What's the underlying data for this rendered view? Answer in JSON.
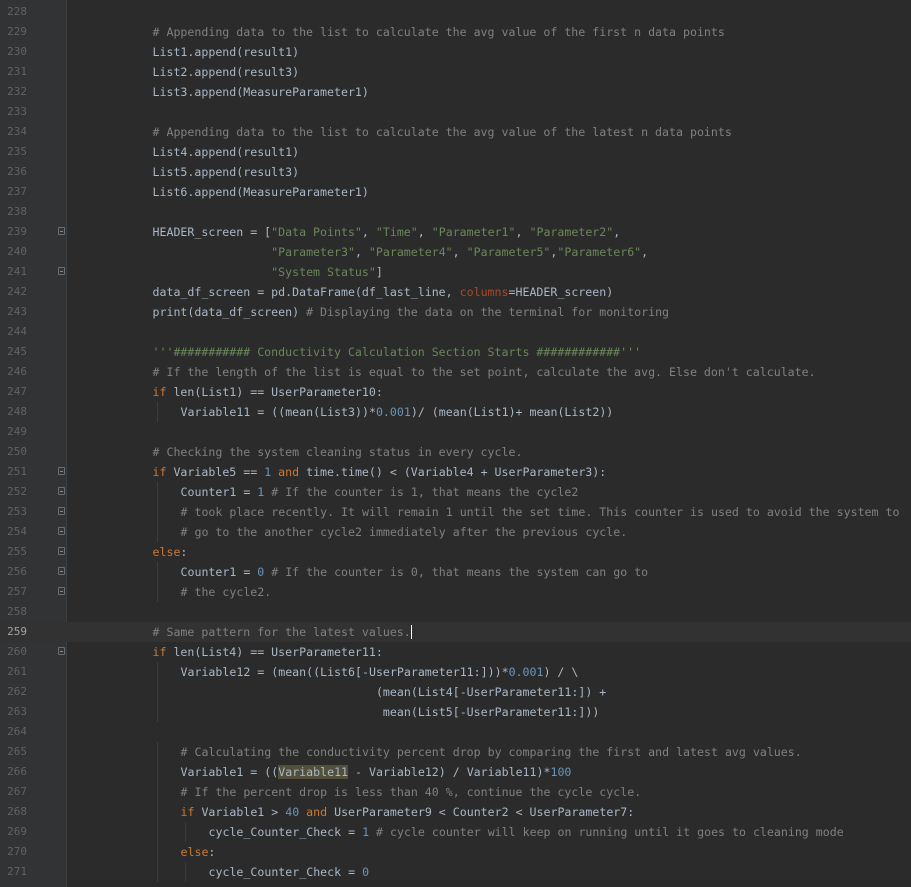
{
  "editor": {
    "colors": {
      "background": "#2b2b2b",
      "gutter": "#313335",
      "keyword": "#cc7832",
      "string": "#6a8759",
      "comment": "#808080",
      "number": "#6897bb",
      "text": "#a9b7c6",
      "kwarg": "#aa4926"
    },
    "current_line": 259,
    "lines": [
      {
        "n": "228",
        "i": 0,
        "s": []
      },
      {
        "n": "229",
        "i": 1,
        "s": [
          [
            "cm",
            "# Appending data to the list to calculate the avg value of the first n data points"
          ]
        ]
      },
      {
        "n": "230",
        "i": 1,
        "s": [
          [
            "t",
            "List1.append(result1)"
          ]
        ]
      },
      {
        "n": "231",
        "i": 1,
        "s": [
          [
            "t",
            "List2.append(result3)"
          ]
        ]
      },
      {
        "n": "232",
        "i": 1,
        "s": [
          [
            "t",
            "List3.append(MeasureParameter1)"
          ]
        ]
      },
      {
        "n": "233",
        "i": 0,
        "s": []
      },
      {
        "n": "234",
        "i": 1,
        "s": [
          [
            "cm",
            "# Appending data to the list to calculate the avg value of the latest n data points"
          ]
        ]
      },
      {
        "n": "235",
        "i": 1,
        "s": [
          [
            "t",
            "List4.append(result1)"
          ]
        ]
      },
      {
        "n": "236",
        "i": 1,
        "s": [
          [
            "t",
            "List5.append(result3)"
          ]
        ]
      },
      {
        "n": "237",
        "i": 1,
        "s": [
          [
            "t",
            "List6.append(MeasureParameter1)"
          ]
        ]
      },
      {
        "n": "238",
        "i": 0,
        "s": []
      },
      {
        "n": "239",
        "i": 1,
        "f": true,
        "s": [
          [
            "t",
            "HEADER_screen = ["
          ],
          [
            "st",
            "\"Data Points\""
          ],
          [
            "t",
            ", "
          ],
          [
            "st",
            "\"Time\""
          ],
          [
            "t",
            ", "
          ],
          [
            "st",
            "\"Parameter1\""
          ],
          [
            "t",
            ", "
          ],
          [
            "st",
            "\"Parameter2\""
          ],
          [
            "t",
            ","
          ]
        ]
      },
      {
        "n": "240",
        "i": 1,
        "s": [
          [
            "t",
            "                 "
          ],
          [
            "st",
            "\"Parameter3\""
          ],
          [
            "t",
            ", "
          ],
          [
            "st",
            "\"Parameter4\""
          ],
          [
            "t",
            ", "
          ],
          [
            "st",
            "\"Parameter5\""
          ],
          [
            "t",
            ","
          ],
          [
            "st",
            "\"Parameter6\""
          ],
          [
            "t",
            ","
          ]
        ]
      },
      {
        "n": "241",
        "i": 1,
        "f": true,
        "s": [
          [
            "t",
            "                 "
          ],
          [
            "st",
            "\"System Status\""
          ],
          [
            "t",
            "]"
          ]
        ]
      },
      {
        "n": "242",
        "i": 1,
        "s": [
          [
            "t",
            "data_df_screen = pd.DataFrame(df_last_line, "
          ],
          [
            "kp",
            "columns"
          ],
          [
            "t",
            "=HEADER_screen)"
          ]
        ]
      },
      {
        "n": "243",
        "i": 1,
        "s": [
          [
            "t",
            "print(data_df_screen) "
          ],
          [
            "cm",
            "# Displaying the data on the terminal for monitoring"
          ]
        ]
      },
      {
        "n": "244",
        "i": 0,
        "s": []
      },
      {
        "n": "245",
        "i": 1,
        "s": [
          [
            "st",
            "'''########### Conductivity Calculation Section Starts ############'''"
          ]
        ]
      },
      {
        "n": "246",
        "i": 1,
        "s": [
          [
            "cm",
            "# If the length of the list is equal to the set point, calculate the avg. Else don't calculate."
          ]
        ]
      },
      {
        "n": "247",
        "i": 1,
        "s": [
          [
            "kw",
            "if "
          ],
          [
            "t",
            "len(List1) == UserParameter10:"
          ]
        ]
      },
      {
        "n": "248",
        "i": 2,
        "s": [
          [
            "t",
            "Variable11 = ((mean(List3))*"
          ],
          [
            "nm",
            "0.001"
          ],
          [
            "t",
            ")/ (mean(List1)+ mean(List2))"
          ]
        ]
      },
      {
        "n": "249",
        "i": 0,
        "s": []
      },
      {
        "n": "250",
        "i": 1,
        "s": [
          [
            "cm",
            "# Checking the system cleaning status in every cycle."
          ]
        ]
      },
      {
        "n": "251",
        "i": 1,
        "f": true,
        "s": [
          [
            "kw",
            "if "
          ],
          [
            "t",
            "Variable5 == "
          ],
          [
            "nm",
            "1"
          ],
          [
            "kw",
            " and "
          ],
          [
            "t",
            "time.time() < (Variable4 + UserParameter3):"
          ]
        ]
      },
      {
        "n": "252",
        "i": 2,
        "f": true,
        "s": [
          [
            "t",
            "Counter1 = "
          ],
          [
            "nm",
            "1"
          ],
          [
            "cm",
            " # If the counter is 1, that means the cycle2"
          ]
        ]
      },
      {
        "n": "253",
        "i": 2,
        "f": true,
        "s": [
          [
            "cm",
            "# took place recently. It will remain 1 until the set time. This counter is used to avoid the system to"
          ]
        ]
      },
      {
        "n": "254",
        "i": 2,
        "f": true,
        "s": [
          [
            "cm",
            "# go to the another cycle2 immediately after the previous cycle."
          ]
        ]
      },
      {
        "n": "255",
        "i": 1,
        "f": true,
        "s": [
          [
            "kw",
            "else"
          ],
          [
            "t",
            ":"
          ]
        ]
      },
      {
        "n": "256",
        "i": 2,
        "f": true,
        "s": [
          [
            "t",
            "Counter1 = "
          ],
          [
            "nm",
            "0"
          ],
          [
            "cm",
            " # If the counter is 0, that means the system can go to"
          ]
        ]
      },
      {
        "n": "257",
        "i": 2,
        "f": true,
        "s": [
          [
            "cm",
            "# the cycle2."
          ]
        ]
      },
      {
        "n": "258",
        "i": 0,
        "s": []
      },
      {
        "n": "259",
        "i": 1,
        "s": [
          [
            "cm",
            "# Same pattern for the latest values."
          ]
        ]
      },
      {
        "n": "260",
        "i": 1,
        "f": true,
        "s": [
          [
            "kw",
            "if "
          ],
          [
            "t",
            "len(List4) == UserParameter11:"
          ]
        ]
      },
      {
        "n": "261",
        "i": 2,
        "s": [
          [
            "t",
            "Variable12 = (mean((List6[-UserParameter11:]))*"
          ],
          [
            "nm",
            "0.001"
          ],
          [
            "t",
            ") / \\"
          ]
        ]
      },
      {
        "n": "262",
        "i": 2,
        "s": [
          [
            "t",
            "                            (mean(List4[-UserParameter11:]) +"
          ]
        ]
      },
      {
        "n": "263",
        "i": 2,
        "s": [
          [
            "t",
            "                             mean(List5[-UserParameter11:]))"
          ]
        ]
      },
      {
        "n": "264",
        "i": 0,
        "s": []
      },
      {
        "n": "265",
        "i": 2,
        "s": [
          [
            "cm",
            "# Calculating the conductivity percent drop by comparing the first and latest avg values."
          ]
        ]
      },
      {
        "n": "266",
        "i": 2,
        "s": [
          [
            "t",
            "Variable1 = (("
          ],
          [
            "hl",
            "Variable11"
          ],
          [
            "t",
            " - Variable12) / Variable11)*"
          ],
          [
            "nm",
            "100"
          ]
        ]
      },
      {
        "n": "267",
        "i": 2,
        "s": [
          [
            "cm",
            "# If the percent drop is less than 40 %, continue the cycle cycle."
          ]
        ]
      },
      {
        "n": "268",
        "i": 2,
        "s": [
          [
            "kw",
            "if "
          ],
          [
            "t",
            "Variable1 > "
          ],
          [
            "nm",
            "40"
          ],
          [
            "kw",
            " and "
          ],
          [
            "t",
            "UserParameter9 < Counter2 < UserParameter7:"
          ]
        ]
      },
      {
        "n": "269",
        "i": 3,
        "s": [
          [
            "t",
            "cycle_Counter_Check = "
          ],
          [
            "nm",
            "1"
          ],
          [
            "cm",
            " # cycle counter will keep on running until it goes to cleaning mode"
          ]
        ]
      },
      {
        "n": "270",
        "i": 2,
        "s": [
          [
            "kw",
            "else"
          ],
          [
            "t",
            ":"
          ]
        ]
      },
      {
        "n": "271",
        "i": 3,
        "s": [
          [
            "t",
            "cycle_Counter_Check = "
          ],
          [
            "nm",
            "0"
          ]
        ]
      }
    ]
  }
}
